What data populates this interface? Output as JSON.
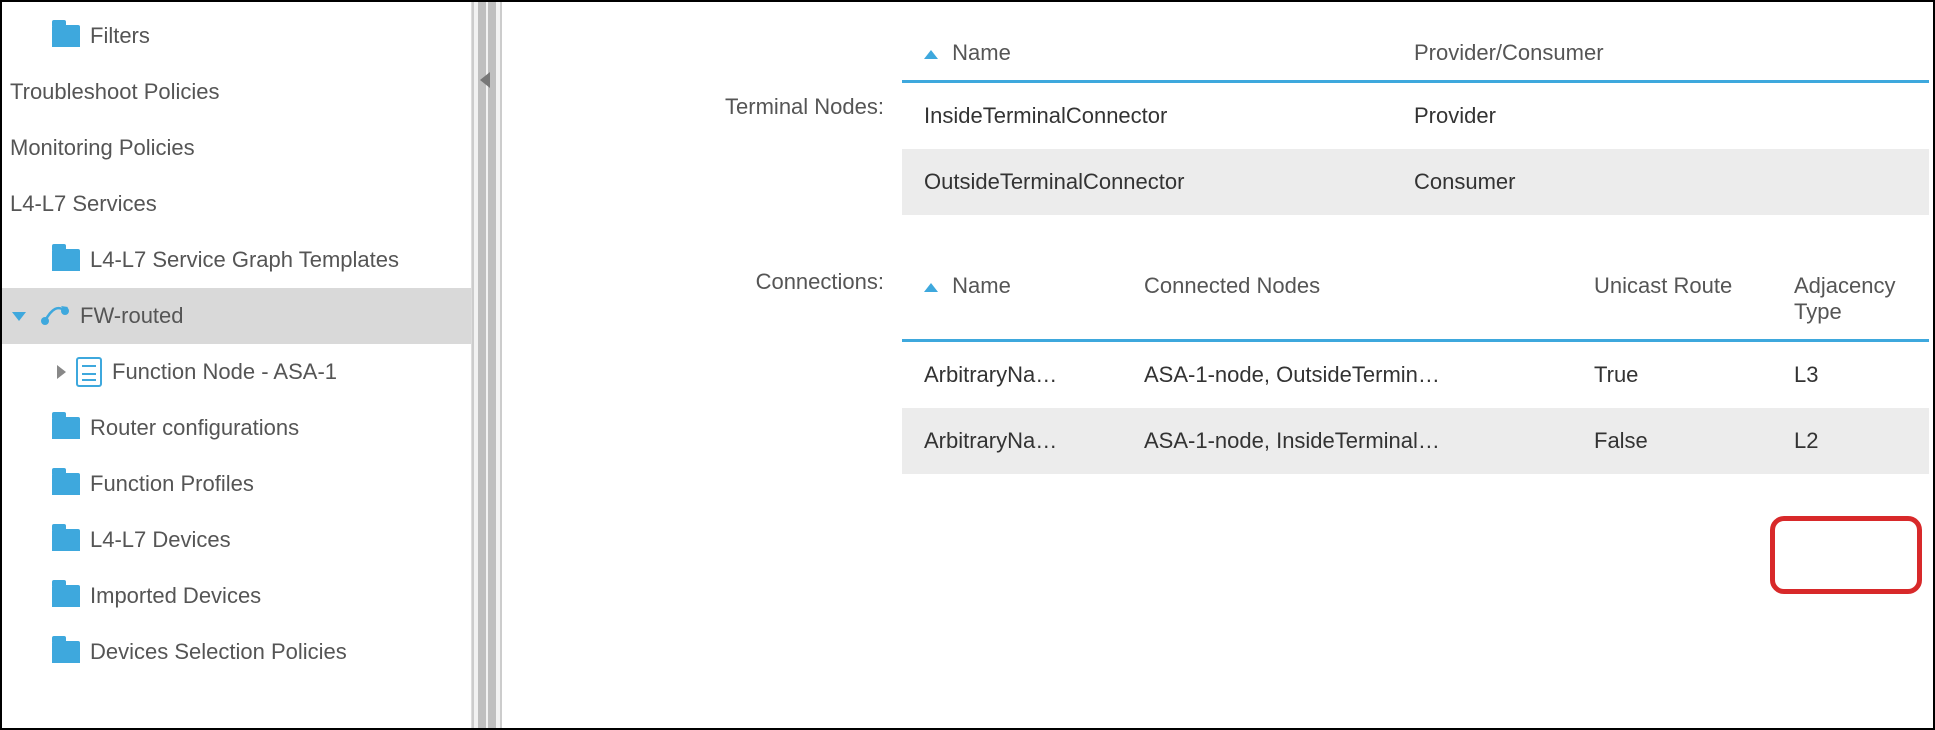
{
  "sidebar": {
    "items": [
      {
        "label": "Filters",
        "icon": "folder",
        "level": "lvl2"
      },
      {
        "label": "Troubleshoot Policies",
        "icon": null,
        "level": "lvl-noicon"
      },
      {
        "label": "Monitoring Policies",
        "icon": null,
        "level": "lvl-noicon"
      },
      {
        "label": "L4-L7 Services",
        "icon": null,
        "level": "lvl-noicon"
      },
      {
        "label": "L4-L7 Service Graph Templates",
        "icon": "folder",
        "level": "lvl2"
      },
      {
        "label": "FW-routed",
        "icon": "service-graph",
        "level": "lvl2",
        "selected": true,
        "disclosure": "down"
      },
      {
        "label": "Function Node - ASA-1",
        "icon": "function-node",
        "level": "lvl3",
        "disclosure": "right"
      },
      {
        "label": "Router configurations",
        "icon": "folder",
        "level": "lvl2"
      },
      {
        "label": "Function Profiles",
        "icon": "folder",
        "level": "lvl2"
      },
      {
        "label": "L4-L7 Devices",
        "icon": "folder",
        "level": "lvl2"
      },
      {
        "label": "Imported Devices",
        "icon": "folder",
        "level": "lvl2"
      },
      {
        "label": "Devices Selection Policies",
        "icon": "folder",
        "level": "lvl2"
      }
    ]
  },
  "main": {
    "terminal_label": "Terminal Nodes:",
    "connections_label": "Connections:",
    "terminal_table": {
      "columns": {
        "name": "Name",
        "pc": "Provider/Consumer"
      },
      "rows": [
        {
          "name": "InsideTerminalConnector",
          "pc": "Provider"
        },
        {
          "name": "OutsideTerminalConnector",
          "pc": "Consumer"
        }
      ]
    },
    "connections_table": {
      "columns": {
        "name": "Name",
        "nodes": "Connected Nodes",
        "uni": "Unicast Route",
        "adj": "Adjacency Type"
      },
      "rows": [
        {
          "name": "ArbitraryNa…",
          "nodes": "ASA-1-node, OutsideTermin…",
          "uni": "True",
          "adj": "L3"
        },
        {
          "name": "ArbitraryNa…",
          "nodes": "ASA-1-node, InsideTerminal…",
          "uni": "False",
          "adj": "L2"
        }
      ]
    }
  }
}
